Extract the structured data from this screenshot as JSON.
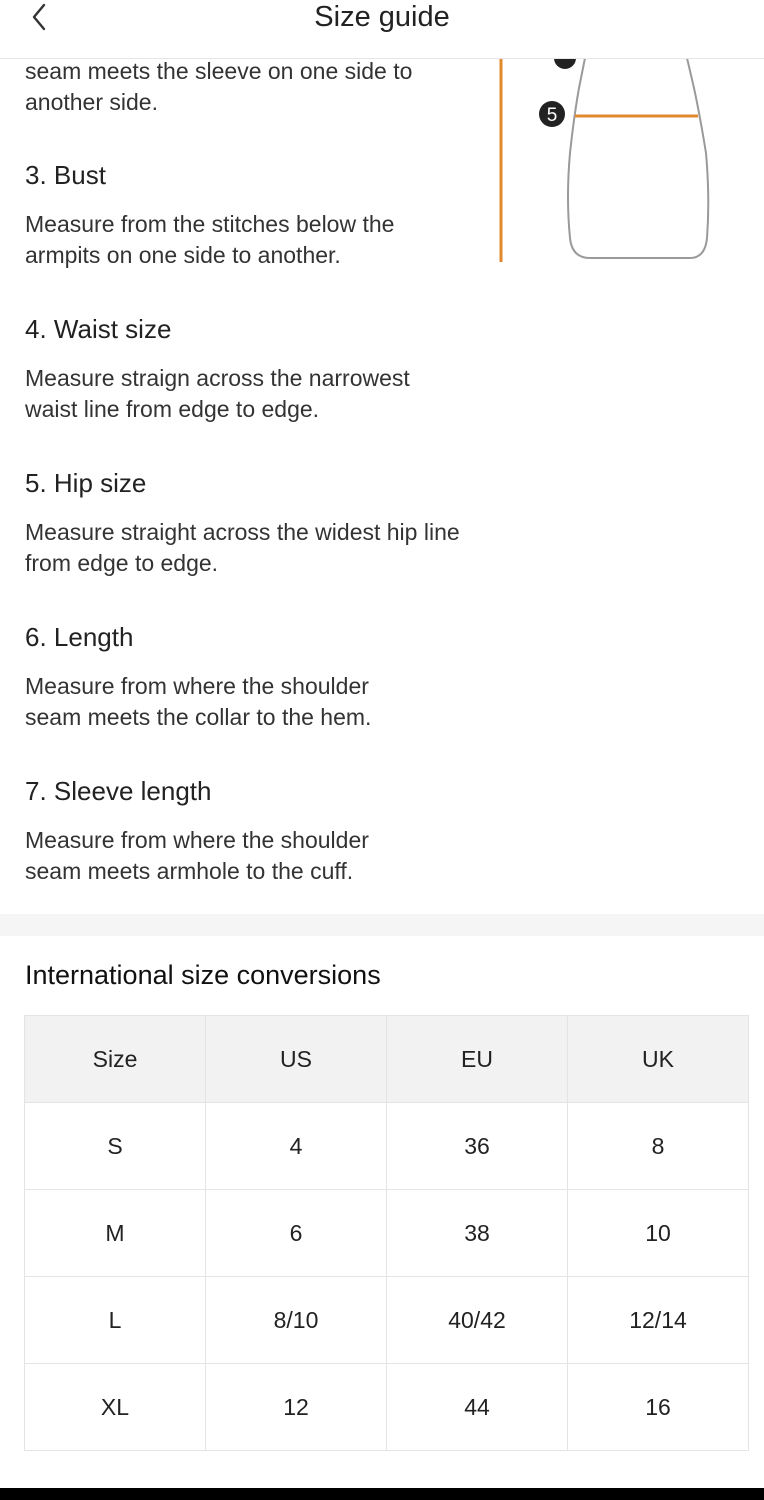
{
  "header": {
    "title": "Size guide",
    "back_icon": "chevron-left-icon"
  },
  "guide": {
    "partial_text": "seam meets the sleeve on one side to another side.",
    "items": [
      {
        "title": "3. Bust",
        "description": "Measure from the stitches below the armpits on one side to another."
      },
      {
        "title": "4. Waist size",
        "description": "Measure straign across the narrowest waist line from edge to edge."
      },
      {
        "title": "5. Hip size",
        "description": "Measure straight across the widest hip line from edge to edge."
      },
      {
        "title": "6. Length",
        "description": "Measure from where the shoulder seam meets the collar to the hem."
      },
      {
        "title": "7. Sleeve length",
        "description": "Measure from where the shoulder seam meets armhole to the cuff."
      }
    ]
  },
  "diagram": {
    "marker_label": "5",
    "accent_color": "#e08a2c"
  },
  "conversions": {
    "title": "International size conversions",
    "headers": [
      "Size",
      "US",
      "EU",
      "UK"
    ],
    "rows": [
      [
        "S",
        "4",
        "36",
        "8"
      ],
      [
        "M",
        "6",
        "38",
        "10"
      ],
      [
        "L",
        "8/10",
        "40/42",
        "12/14"
      ],
      [
        "XL",
        "12",
        "44",
        "16"
      ]
    ]
  }
}
